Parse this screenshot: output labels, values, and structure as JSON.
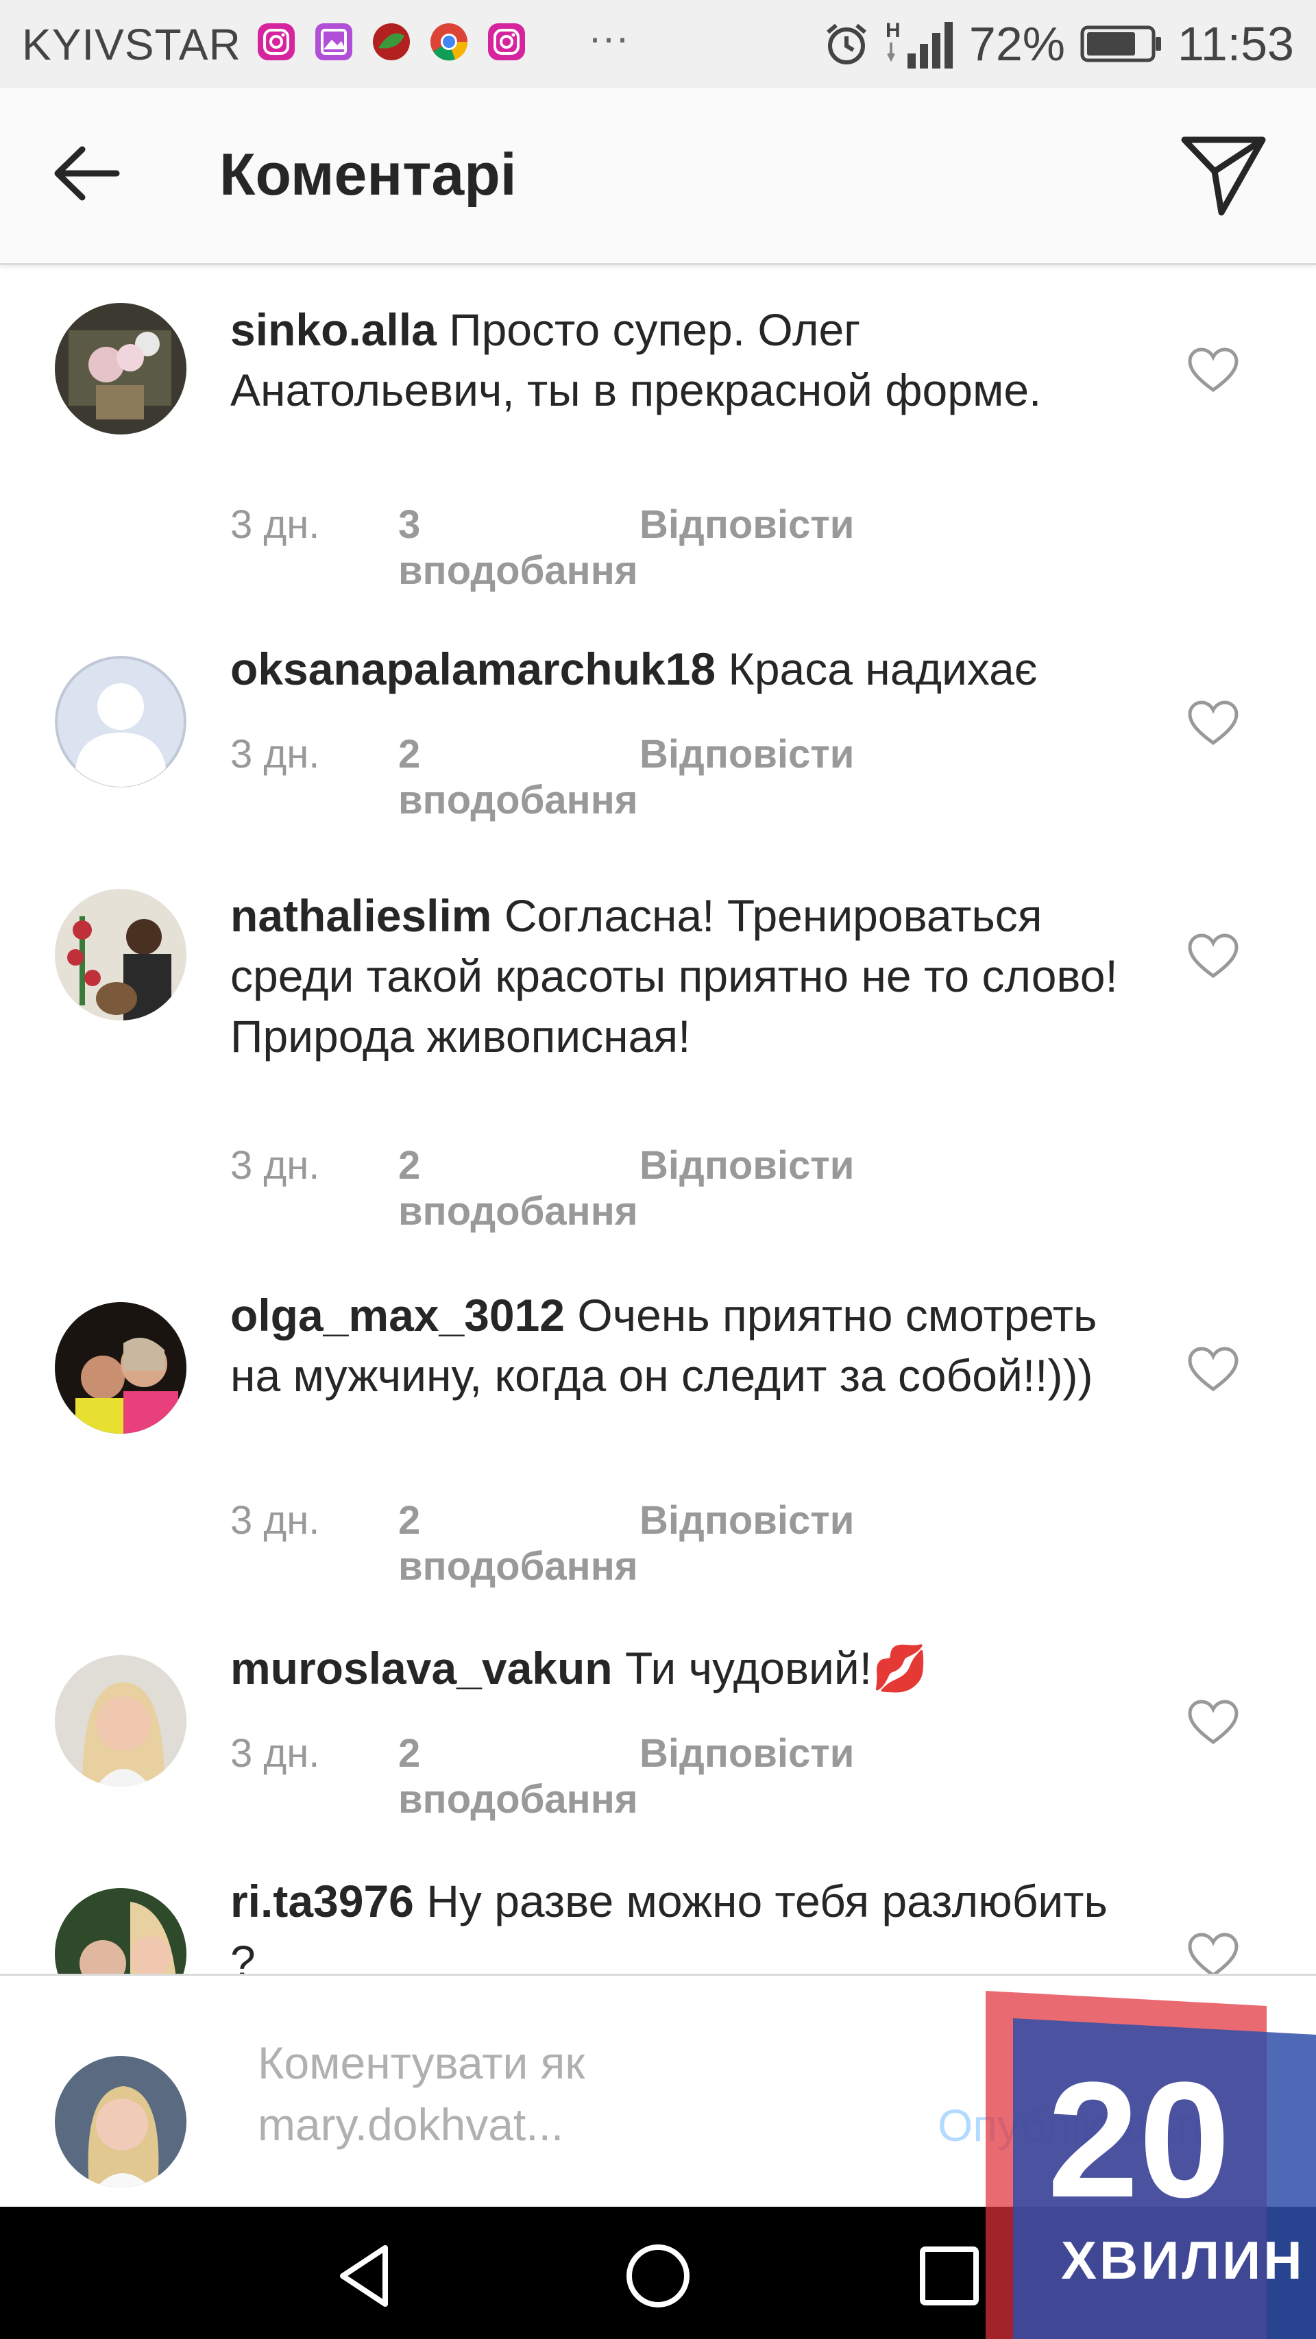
{
  "status_bar": {
    "carrier": "KYIVSTAR",
    "app_icons": [
      "instagram-icon",
      "gallery-icon",
      "app-icon",
      "chrome-icon",
      "instagram-icon"
    ],
    "more": "···",
    "network": "H",
    "battery": "72%",
    "time": "11:53"
  },
  "header": {
    "title": "Коментарі"
  },
  "comments": [
    {
      "username": "sinko.alla",
      "text": "Просто супер. Олег Анатольевич, ты в прекрасной форме.",
      "time": "3 дн.",
      "likes": "3 вподобання",
      "reply": "Відповісти",
      "avatar": "photo"
    },
    {
      "username": "oksanapalamarchuk18",
      "text": "Краса надихає",
      "time": "3 дн.",
      "likes": "2 вподобання",
      "reply": "Відповісти",
      "avatar": "default"
    },
    {
      "username": "nathalieslim",
      "text": "Согласна! Тренироваться среди такой красоты приятно не то слово! Природа живописная!",
      "time": "3 дн.",
      "likes": "2 вподобання",
      "reply": "Відповісти",
      "avatar": "photo"
    },
    {
      "username": "olga_max_3012",
      "text": "Очень приятно смотреть на мужчину, когда он следит за собой!!)))",
      "time": "3 дн.",
      "likes": "2 вподобання",
      "reply": "Відповісти",
      "avatar": "photo"
    },
    {
      "username": "muroslava_vakun",
      "text": "Ти чудовий!💋",
      "time": "3 дн.",
      "likes": "2 вподобання",
      "reply": "Відповісти",
      "avatar": "photo"
    },
    {
      "username": "ri.ta3976",
      "text": "Ну разве можно тебя разлюбить ?",
      "avatar": "photo"
    }
  ],
  "composer": {
    "placeholder_line1": "Коментувати як",
    "placeholder_line2": "mary.dokhvat...",
    "publish": "Опублікувати"
  },
  "watermark": {
    "number": "20",
    "word": "ХВИЛИН"
  },
  "colors": {
    "text": "#262626",
    "meta": "#999999",
    "publish_disabled": "#b3dbff",
    "header_bg": "#fafafa",
    "status_bar_bg": "#f0f0f0",
    "watermark_blue": "#2f4fa8",
    "watermark_red": "#e0303a"
  }
}
